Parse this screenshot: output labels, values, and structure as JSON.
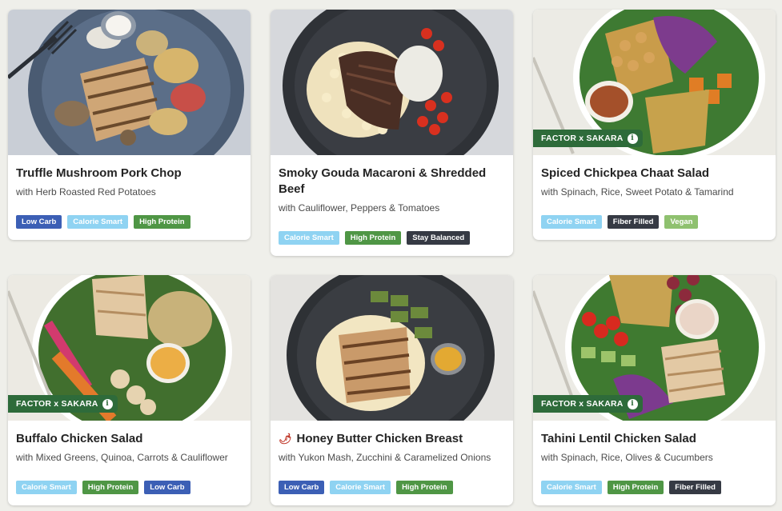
{
  "brand_badge_label": "FACTOR x SAKARA",
  "tag_colors": {
    "Low Carb": "#3c5fb5",
    "Calorie Smart": "#8fd3f2",
    "High Protein": "#4f9645",
    "Stay Balanced": "#363a44",
    "Fiber Filled": "#363a44",
    "Vegan": "#8fc16f"
  },
  "meals": [
    {
      "title": "Truffle Mushroom Pork Chop",
      "subtitle": "with Herb Roasted Red Potatoes",
      "spicy": false,
      "partner_badge": false,
      "photo": "pork-chop-plate-photo",
      "tags": [
        "Low Carb",
        "Calorie Smart",
        "High Protein"
      ]
    },
    {
      "title": "Smoky Gouda Macaroni & Shredded Beef",
      "subtitle": "with Cauliflower, Peppers & Tomatoes",
      "spicy": false,
      "partner_badge": false,
      "photo": "macaroni-beef-plate-photo",
      "tags": [
        "Calorie Smart",
        "High Protein",
        "Stay Balanced"
      ]
    },
    {
      "title": "Spiced Chickpea Chaat Salad",
      "subtitle": "with Spinach, Rice, Sweet Potato & Tamarind",
      "spicy": false,
      "partner_badge": true,
      "photo": "chickpea-salad-bowl-photo",
      "tags": [
        "Calorie Smart",
        "Fiber Filled",
        "Vegan"
      ]
    },
    {
      "title": "Buffalo Chicken Salad",
      "subtitle": "with Mixed Greens, Quinoa, Carrots & Cauliflower",
      "spicy": false,
      "partner_badge": true,
      "photo": "buffalo-chicken-salad-photo",
      "tags": [
        "Calorie Smart",
        "High Protein",
        "Low Carb"
      ]
    },
    {
      "title": "Honey Butter Chicken Breast",
      "subtitle": "with Yukon Mash, Zucchini & Caramelized Onions",
      "spicy": true,
      "spicy_icon": "chili-pepper-icon",
      "partner_badge": false,
      "photo": "honey-butter-chicken-plate-photo",
      "tags": [
        "Low Carb",
        "Calorie Smart",
        "High Protein"
      ]
    },
    {
      "title": "Tahini Lentil Chicken Salad",
      "subtitle": "with Spinach, Rice, Olives & Cucumbers",
      "spicy": false,
      "partner_badge": true,
      "photo": "tahini-lentil-salad-photo",
      "tags": [
        "Calorie Smart",
        "High Protein",
        "Fiber Filled"
      ]
    }
  ]
}
